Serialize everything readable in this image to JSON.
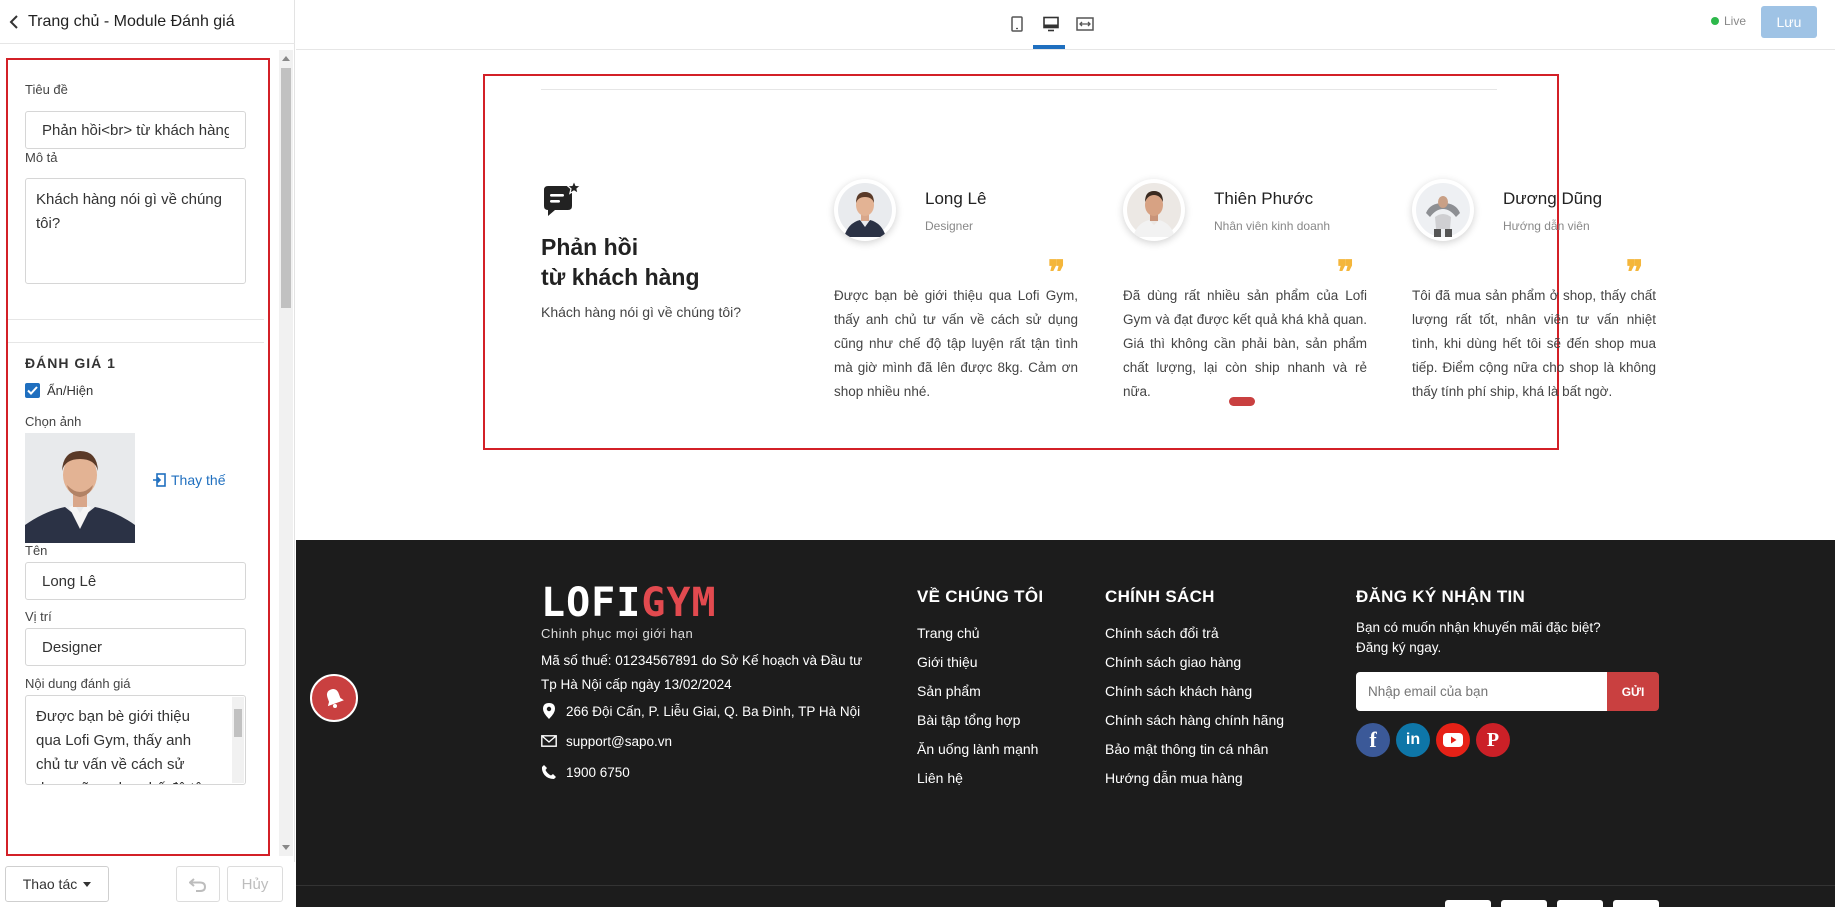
{
  "panel": {
    "title": "Trang chủ - Module Đánh giá",
    "heading_section": {
      "title_label": "Tiêu đề",
      "title_value": "Phản hồi<br> từ khách hàng",
      "desc_label": "Mô tả",
      "desc_value": "Khách hàng nói gì về chúng tôi?"
    },
    "review_section": {
      "title": "ĐÁNH GIÁ 1",
      "toggle_label": "Ẩn/Hiện",
      "image_label": "Chọn ảnh",
      "replace_label": "Thay thế",
      "name_label": "Tên",
      "name_value": "Long Lê",
      "position_label": "Vị trí",
      "position_value": "Designer",
      "content_label": "Nội dung đánh giá",
      "content_value": "Được bạn bè giới thiệu qua Lofi Gym, thấy anh chủ tư vấn về cách sử dụng cũng như chế độ tập luyện rất tận tình mà giờ mình đã lên được 8kg. Cảm ơn shop nhiều nhé."
    },
    "footer": {
      "actions_label": "Thao tác",
      "cancel_label": "Hủy"
    }
  },
  "topbar": {
    "live_label": "Live",
    "save_label": "Lưu",
    "active_device": "desktop"
  },
  "preview": {
    "testimonial": {
      "heading_line1": "Phản hồi",
      "heading_line2": "từ khách hàng",
      "subtitle": "Khách hàng nói gì về chúng tôi?",
      "quote_mark": "❞",
      "reviews": [
        {
          "name": "Long Lê",
          "role": "Designer",
          "text": "Được bạn bè giới thiệu qua Lofi Gym, thấy anh chủ tư vấn về cách sử dụng cũng như chế độ tập luyện rất tận tình mà giờ mình đã lên được 8kg. Cảm ơn shop nhiều nhé."
        },
        {
          "name": "Thiên Phước",
          "role": "Nhân viên kinh doanh",
          "text": "Đã dùng rất nhiều sản phẩm của Lofi Gym và đạt được kết quả khá khả quan. Giá thì không cần phải bàn, sản phẩm chất lượng, lại còn ship nhanh và rẻ nữa."
        },
        {
          "name": "Dương Dũng",
          "role": "Hướng dẫn viên",
          "text": "Tôi đã mua sản phẩm ở shop, thấy chất lượng rất tốt, nhân viên tư vấn nhiệt tình, khi dùng hết tôi sẽ đến shop mua tiếp. Điểm cộng nữa cho shop là không thấy tính phí ship, khá là bất ngờ."
        }
      ]
    },
    "footer": {
      "logo_part1": "LOFI",
      "logo_part2": "GYM",
      "slogan": "Chinh phục mọi giới hạn",
      "tax_info": "Mã số thuế: 01234567891 do Sở Kế hoạch và Đầu tư Tp Hà Nội cấp ngày 13/02/2024",
      "address": "266 Đội Cấn, P. Liễu Giai, Q. Ba Đình, TP Hà Nội",
      "email": "support@sapo.vn",
      "phone": "1900 6750",
      "about": {
        "title": "VỀ CHÚNG TÔI",
        "links": [
          "Trang chủ",
          "Giới thiệu",
          "Sản phẩm",
          "Bài tập tổng hợp",
          "Ăn uống lành mạnh",
          "Liên hệ"
        ]
      },
      "policy": {
        "title": "CHÍNH SÁCH",
        "links": [
          "Chính sách đổi trả",
          "Chính sách giao hàng",
          "Chính sách khách hàng",
          "Chính sách hàng chính hãng",
          "Bảo mật thông tin cá nhân",
          "Hướng dẫn mua hàng"
        ]
      },
      "newsletter": {
        "title": "ĐĂNG KÝ NHẬN TIN",
        "desc_line1": "Bạn có muốn nhận khuyến mãi đặc biệt?",
        "desc_line2": "Đăng ký ngay.",
        "email_placeholder": "Nhập email của bạn",
        "subscribe_label": "GỬI"
      },
      "social": {
        "facebook": "f",
        "linkedin": "in",
        "pinterest": "P"
      }
    }
  },
  "colors": {
    "accent_blue": "#1f6fbf",
    "brand_red": "#c94040",
    "outline_red": "#d32027",
    "quote_yellow": "#f4b63b",
    "footer_bg": "#1c1c1c"
  }
}
